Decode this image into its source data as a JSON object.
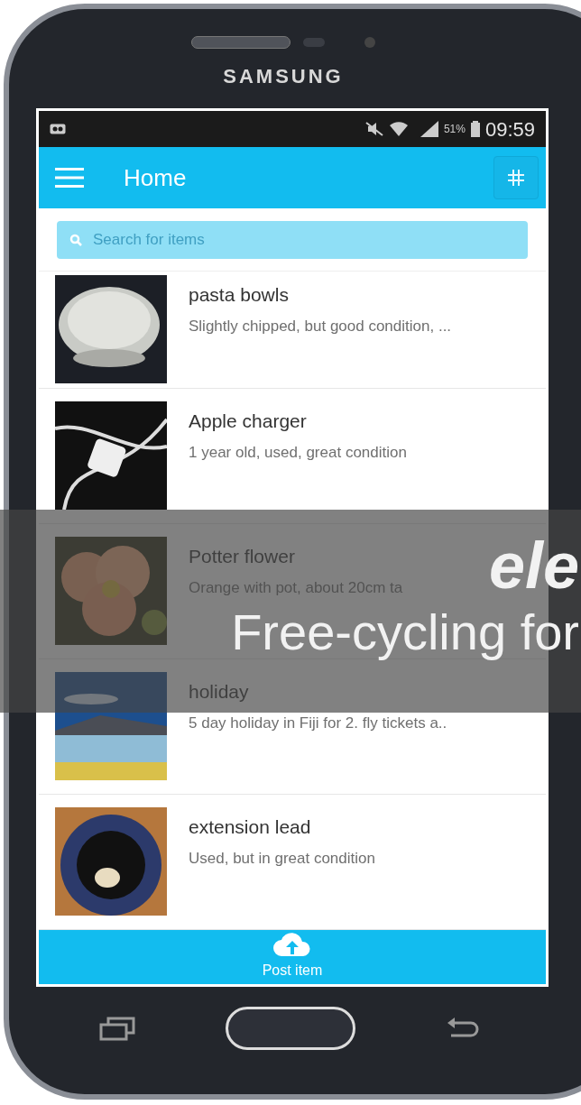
{
  "device": {
    "brand": "SAMSUNG"
  },
  "status_bar": {
    "battery": "51%",
    "time": "09:59"
  },
  "header": {
    "title": "Home"
  },
  "search": {
    "placeholder": "Search for items"
  },
  "items": [
    {
      "title": "pasta bowls",
      "description": "Slightly chipped, but good condition, ..."
    },
    {
      "title": "Apple charger",
      "description": "1 year old, used, great condition"
    },
    {
      "title": "Potter flower",
      "description": "Orange with pot, about 20cm ta"
    },
    {
      "title": "holiday",
      "description": "5 day holiday in Fiji for 2. fly tickets a.."
    },
    {
      "title": "extension lead",
      "description": "Used, but in great condition"
    }
  ],
  "bottom_bar": {
    "label": "Post item"
  },
  "banner": {
    "title": "ele",
    "subtitle": "Free-cycling for"
  }
}
